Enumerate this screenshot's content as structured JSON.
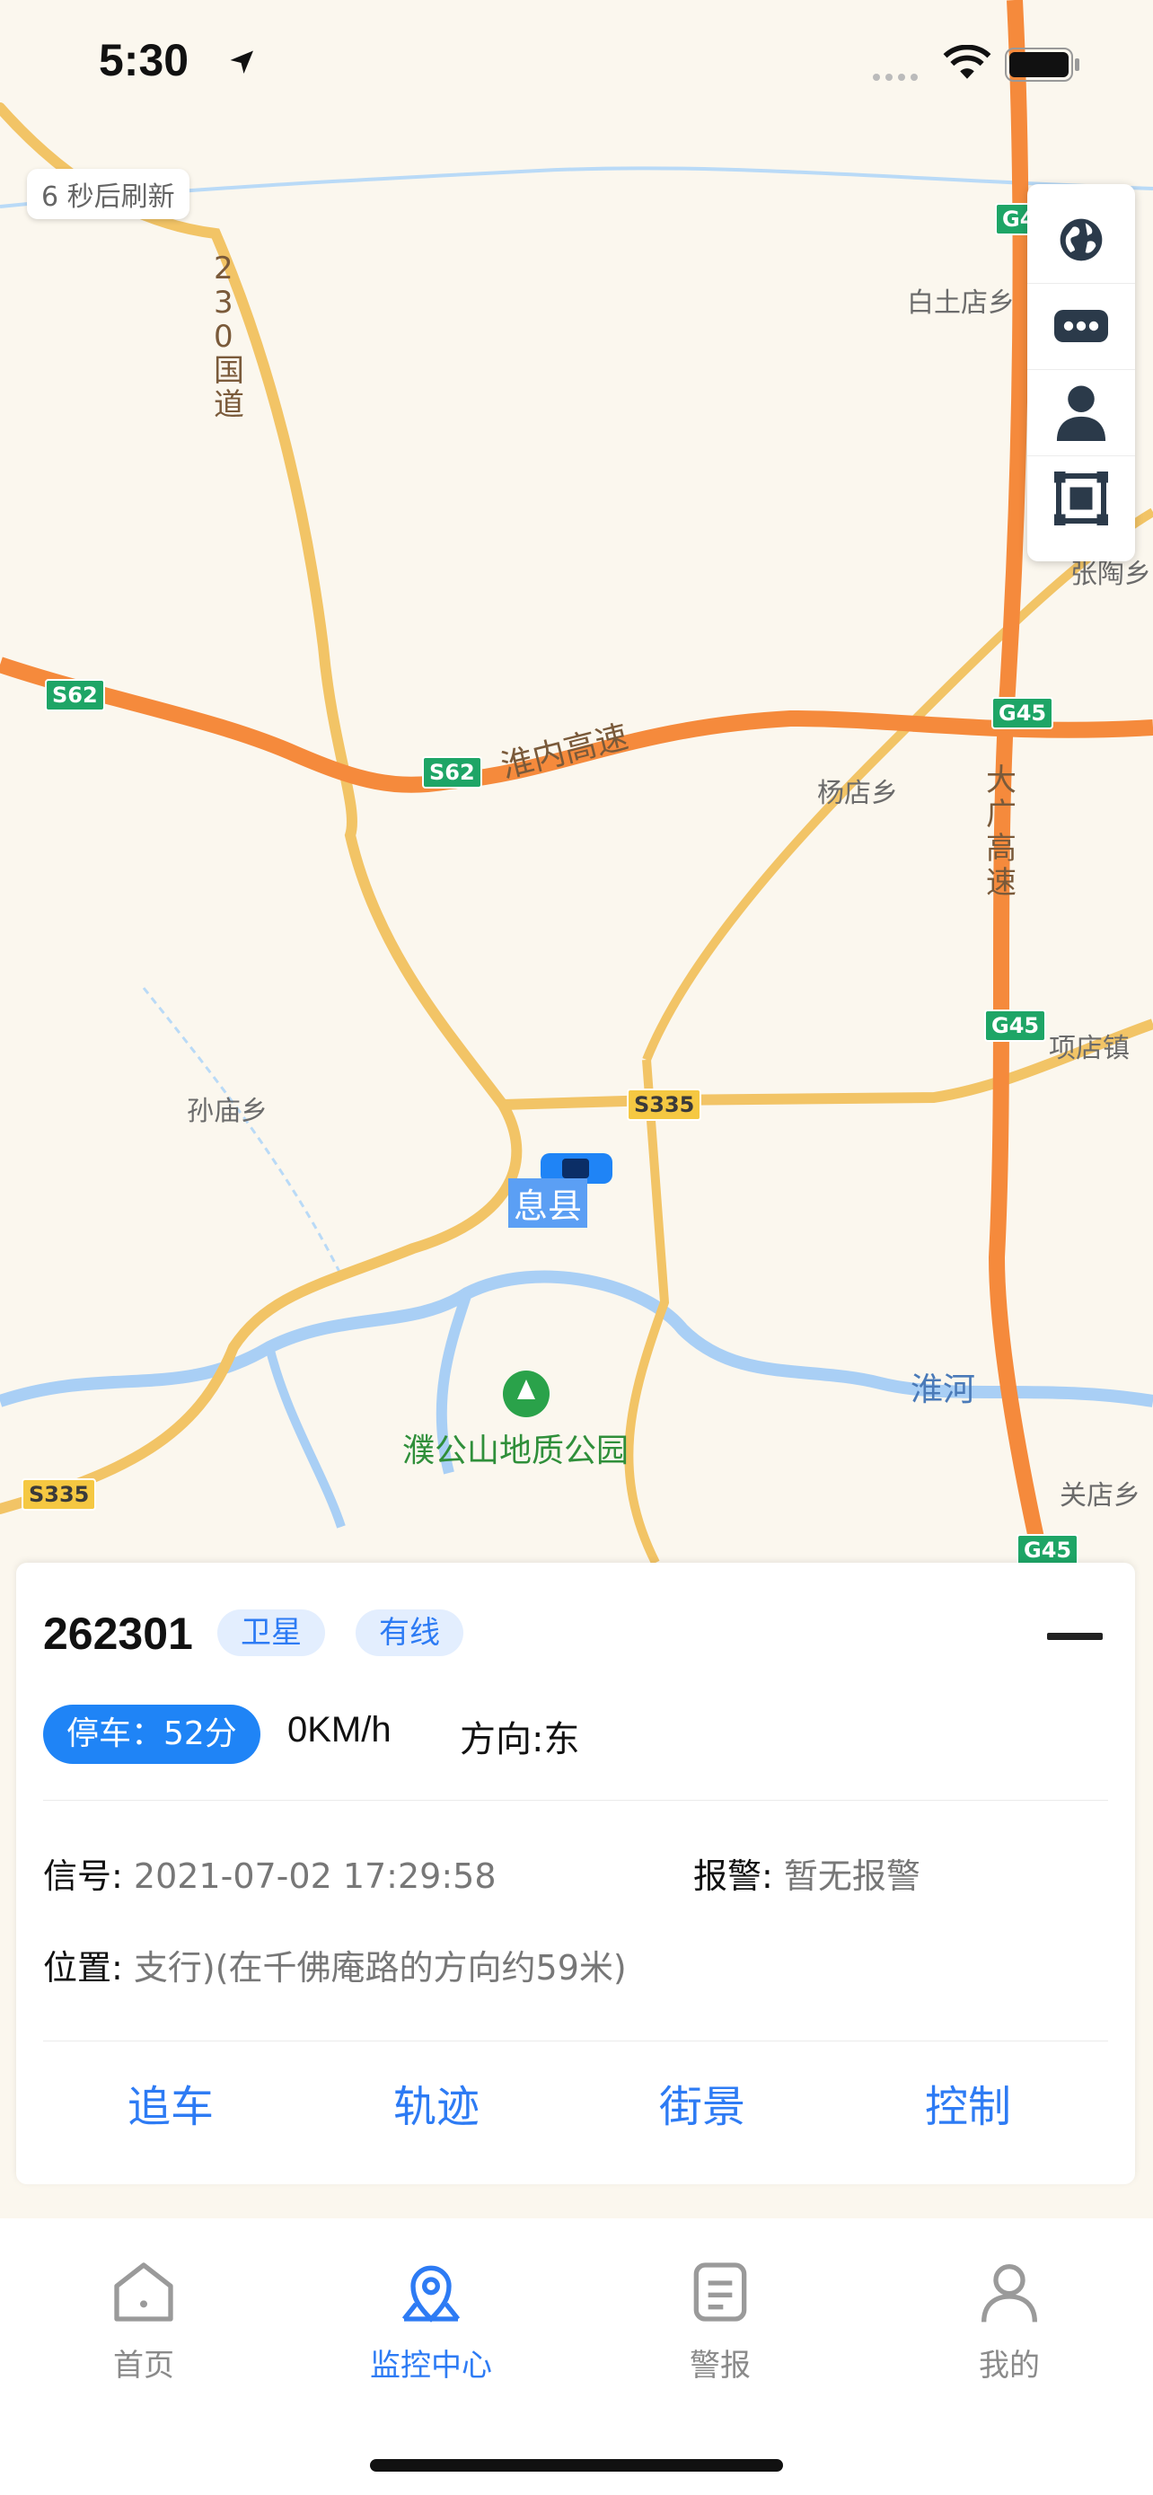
{
  "status_bar": {
    "time": "5:30"
  },
  "map": {
    "refresh_text": "6 秒后刷新",
    "labels": {
      "baitudian": "白土店乡",
      "zhangtao": "张陶乡",
      "yangdian": "杨店乡",
      "xiangdian": "项店镇",
      "sunmiao": "孙庙乡",
      "guandian": "关店乡",
      "huaihe": "淮河",
      "huainei": "淮内高速",
      "daguang": "大广高速",
      "guodao": "230国道",
      "xixian": "息县",
      "park": "濮公山地质公园"
    },
    "shields": {
      "s62a": "S62",
      "s62b": "S62",
      "s335a": "S335",
      "s335b": "S335",
      "g45a": "G45",
      "g45b": "G45",
      "g45c": "G45",
      "g4": "G4"
    }
  },
  "vehicle": {
    "id": "262301",
    "tags": [
      "卫星",
      "有线"
    ],
    "park_status": "停车：52分",
    "speed": "0KM/h",
    "direction": "方向:东",
    "signal_label": "信号:",
    "signal_value": "2021-07-02 17:29:58",
    "alarm_label": "报警:",
    "alarm_value": "暂无报警",
    "location_label": "位置:",
    "location_value": "支行)(在千佛庵路的方向约59米)",
    "actions": [
      "追车",
      "轨迹",
      "街景",
      "控制"
    ]
  },
  "tabs": [
    {
      "label": "首页",
      "icon": "home-icon"
    },
    {
      "label": "监控中心",
      "icon": "map-monitor-icon"
    },
    {
      "label": "警报",
      "icon": "alert-doc-icon"
    },
    {
      "label": "我的",
      "icon": "user-icon"
    }
  ],
  "colors": {
    "accent": "#2d7bf4",
    "highway": "#f58a3c",
    "road": "#f2c466",
    "water": "#a9cff5"
  }
}
